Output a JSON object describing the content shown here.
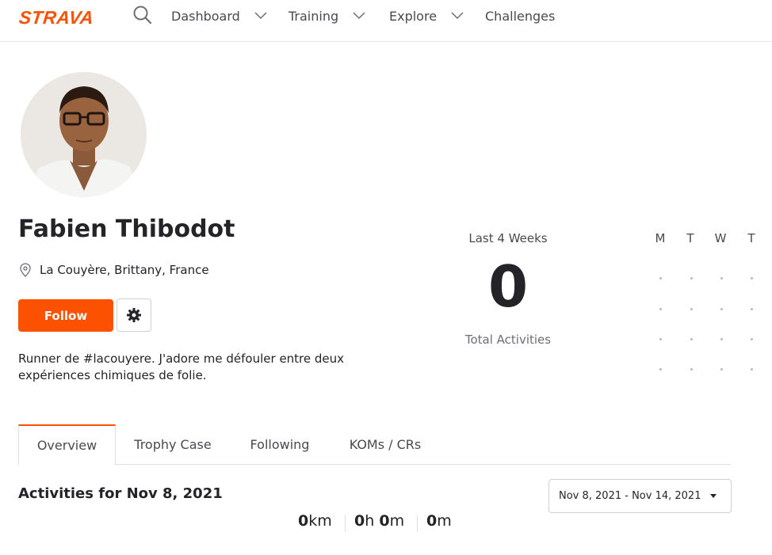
{
  "header": {
    "logo": "STRAVA",
    "nav": [
      {
        "label": "Dashboard"
      },
      {
        "label": "Training"
      },
      {
        "label": "Explore"
      },
      {
        "label": "Challenges"
      }
    ]
  },
  "profile": {
    "name": "Fabien Thibodot",
    "location": "La Couyère, Brittany, France",
    "follow_label": "Follow",
    "bio": "Runner de #lacouyere. J'adore me défouler entre deux expériences chimiques de folie."
  },
  "stats": {
    "period_label": "Last 4 Weeks",
    "total_value": "0",
    "total_label": "Total Activities",
    "day_headers": [
      "M",
      "T",
      "W",
      "T"
    ]
  },
  "tabs": [
    {
      "label": "Overview"
    },
    {
      "label": "Trophy Case"
    },
    {
      "label": "Following"
    },
    {
      "label": "KOMs / CRs"
    }
  ],
  "activities": {
    "title": "Activities for Nov 8, 2021",
    "date_range": "Nov 8, 2021 - Nov 14, 2021",
    "distance_value": "0",
    "distance_unit": "km",
    "hours_value": "0",
    "hours_unit": "h",
    "minutes_value": "0",
    "minutes_unit": "m",
    "elevation_value": "0",
    "elevation_unit": "m"
  },
  "colors": {
    "brand": "#fc5200"
  }
}
